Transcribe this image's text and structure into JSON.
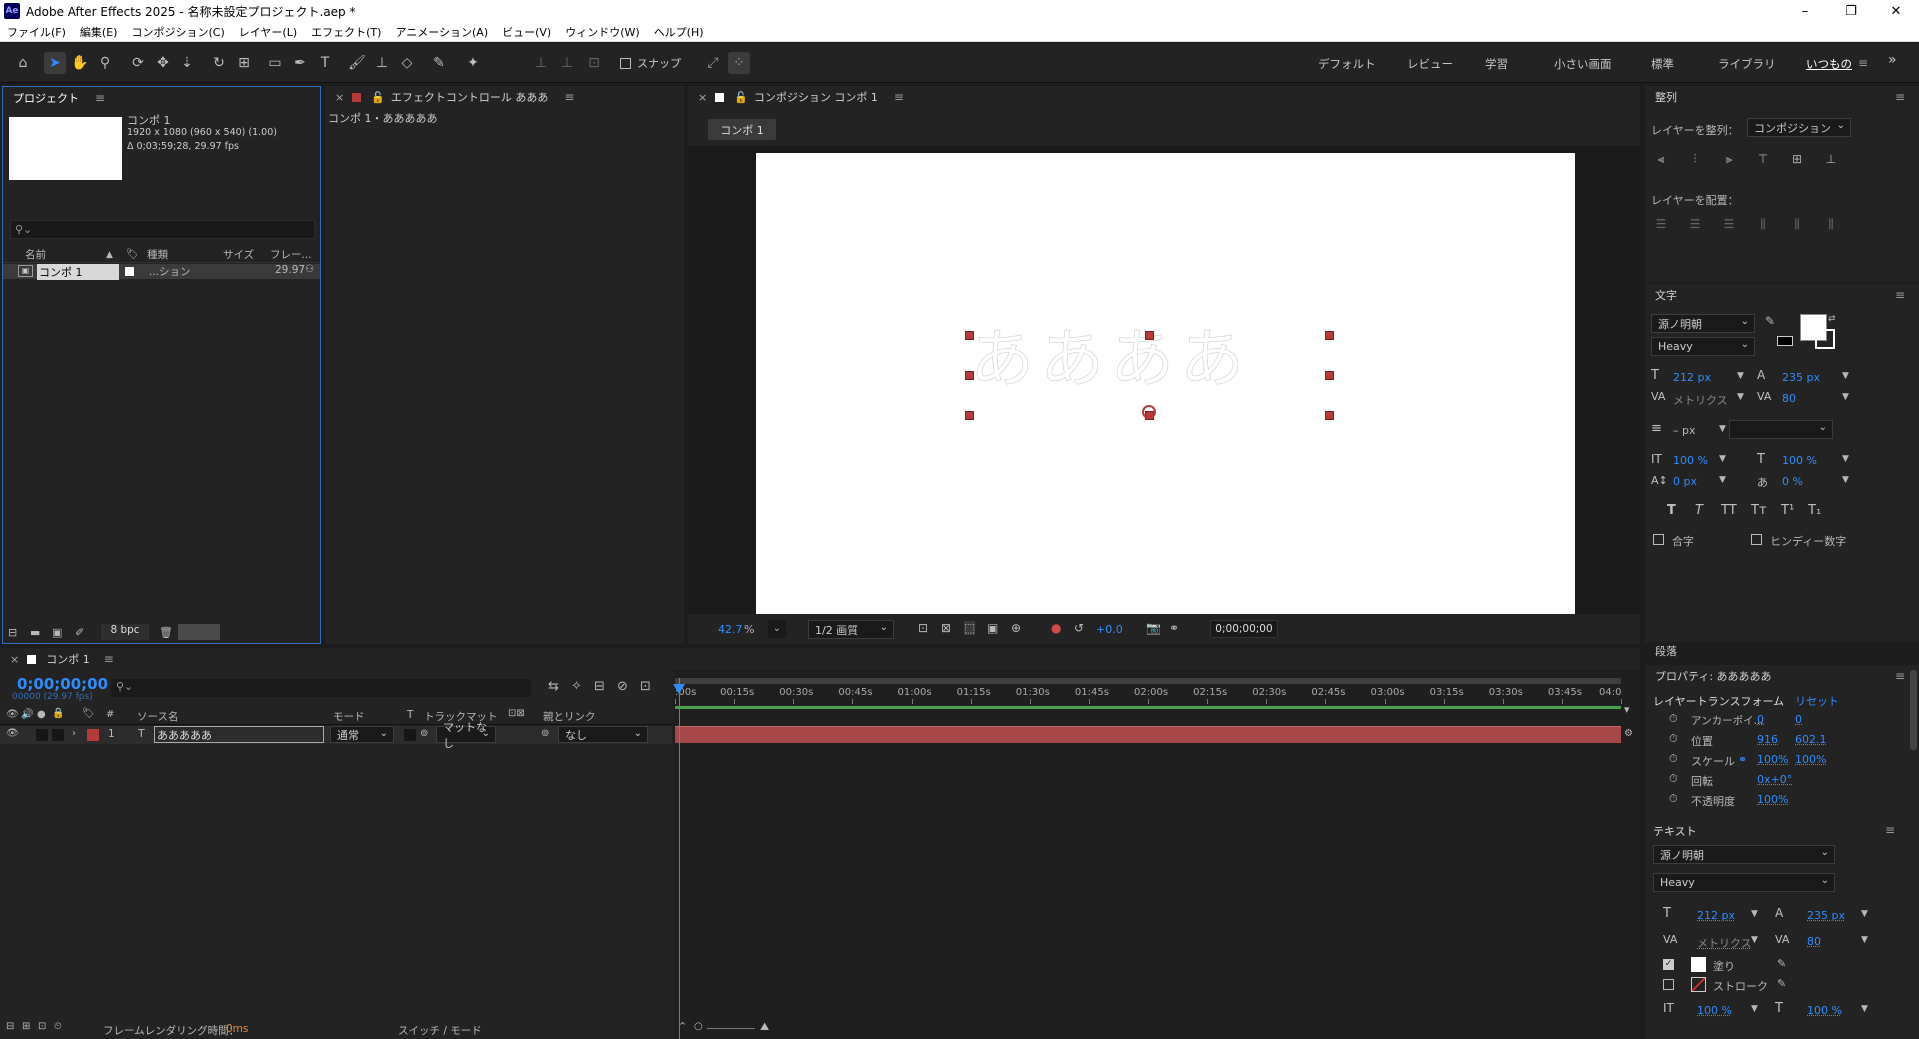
{
  "window": {
    "app_icon": "Ae",
    "title": "Adobe After Effects 2025 - 名称未設定プロジェクト.aep *",
    "controls": [
      "–",
      "❐",
      "✕"
    ]
  },
  "menu": [
    "ファイル(F)",
    "編集(E)",
    "コンポジション(C)",
    "レイヤー(L)",
    "エフェクト(T)",
    "アニメーション(A)",
    "ビュー(V)",
    "ウィンドウ(W)",
    "ヘルプ(H)"
  ],
  "toolbar": {
    "snap_label": "スナップ",
    "workspaces": [
      "デフォルト",
      "レビュー",
      "学習",
      "小さい画面",
      "標準",
      "ライブラリ",
      "いつもの"
    ],
    "active_workspace": "いつもの",
    "more": "»"
  },
  "project": {
    "title": "プロジェクト",
    "item_name": "コンポ 1",
    "item_dims": "1920 x 1080  (960 x 540) (1.00)",
    "item_duration": "Δ 0;03;59;28, 29.97 fps",
    "search_placeholder": "",
    "columns": [
      "名前",
      "種類",
      "サイズ",
      "フレー..."
    ],
    "rows": [
      {
        "name": "コンポ 1",
        "type": "...ション",
        "size": "",
        "fps": "29.97"
      }
    ],
    "bpc": "8 bpc"
  },
  "effects": {
    "title": "エフェクトコントロール あああ",
    "sub": "コンポ 1・あああああ"
  },
  "composition": {
    "title": "コンポジション コンポ 1",
    "tab": "コンポ 1",
    "text_content": "ああああ",
    "zoom": "42.7",
    "zoom_unit": "%",
    "quality": "1/2 画質",
    "exposure": "+0.0",
    "timecode": "0;00;00;00"
  },
  "align": {
    "title": "整列",
    "align_to_label": "レイヤーを整列：",
    "align_to_value": "コンポジション",
    "distribute_label": "レイヤーを配置："
  },
  "character": {
    "title": "文字",
    "font": "源ノ明朝",
    "style": "Heavy",
    "size": "212 px",
    "leading": "235 px",
    "kerning": "メトリクス",
    "tracking": "80",
    "stroke_width": "– px",
    "vscale": "100 %",
    "hscale": "100 %",
    "baseline": "0 px",
    "tsume": "0 %",
    "styles": [
      "T",
      "T",
      "TT",
      "Tт",
      "T¹",
      "T₁"
    ],
    "ligatures": "合字",
    "hindi": "ヒンディー数字"
  },
  "paragraph": {
    "title": "段落"
  },
  "properties": {
    "title": "プロパティ: あああああ",
    "layer_transform": "レイヤートランスフォーム",
    "reset": "リセット",
    "anchor_label": "アンカーポイ...",
    "anchor_x": "0",
    "anchor_y": "0",
    "position_label": "位置",
    "position_x": "916",
    "position_y": "602.1",
    "scale_label": "スケール",
    "scale_x": "100%",
    "scale_y": "100%",
    "rotation_label": "回転",
    "rotation": "0x+0°",
    "opacity_label": "不透明度",
    "opacity": "100%",
    "text_section": "テキスト",
    "font": "源ノ明朝",
    "style": "Heavy",
    "size": "212 px",
    "leading": "235 px",
    "kerning": "メトリクス",
    "tracking": "80",
    "fill_label": "塗り",
    "stroke_label": "ストローク",
    "vscale": "100 %",
    "hscale": "100 %"
  },
  "timeline": {
    "tab": "コンポ 1",
    "timecode": "0;00;00;00",
    "fps_info": "00000 (29.97 fps)",
    "columns": {
      "num": "#",
      "source": "ソース名",
      "mode": "モード",
      "t": "T",
      "trackmatte": "トラックマット",
      "parent": "親とリンク"
    },
    "layer": {
      "num": "1",
      "name": "あああああ",
      "mode": "通常",
      "matte": "マットなし",
      "parent": "なし"
    },
    "ruler": [
      ":00s",
      "00:15s",
      "00:30s",
      "00:45s",
      "01:00s",
      "01:15s",
      "01:30s",
      "01:45s",
      "02:00s",
      "02:15s",
      "02:30s",
      "02:45s",
      "03:00s",
      "03:15s",
      "03:30s",
      "03:45s",
      "04:0"
    ],
    "render_time": "フレームレンダリング時間：",
    "render_value": "0ms",
    "switch_mode": "スイッチ / モード"
  },
  "colors": {
    "accent": "#2f8cff",
    "label_red": "#b53a3a",
    "layer_bar": "#a64848"
  }
}
